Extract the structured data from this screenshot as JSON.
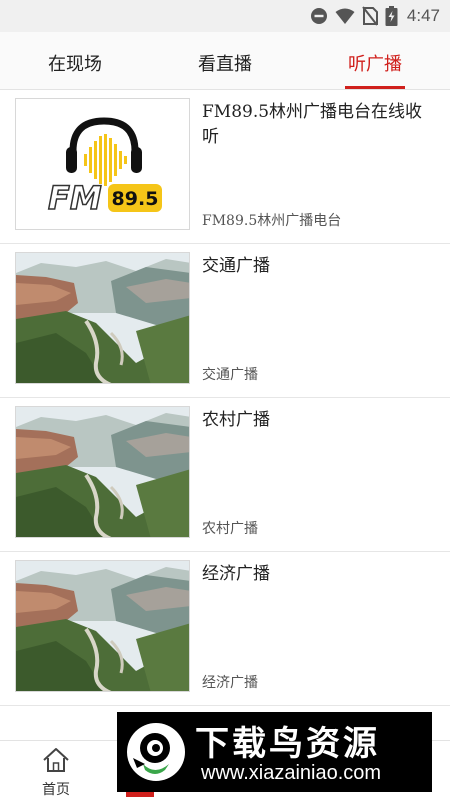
{
  "status_bar": {
    "time": "4:47",
    "icons": [
      "dnd-icon",
      "wifi-icon",
      "no-sim-icon",
      "battery-charging-icon"
    ]
  },
  "tabs": [
    {
      "label": "在现场",
      "active": false
    },
    {
      "label": "看直播",
      "active": false
    },
    {
      "label": "听广播",
      "active": true
    }
  ],
  "list": [
    {
      "title": "FM89.5林州广播电台在线收听",
      "subtitle": "FM89.5林州广播电台",
      "thumb": "fm-logo",
      "logo_text": "FM",
      "logo_freq": "89.5"
    },
    {
      "title": "交通广播",
      "subtitle": "交通广播",
      "thumb": "mountain-photo"
    },
    {
      "title": "农村广播",
      "subtitle": "农村广播",
      "thumb": "mountain-photo"
    },
    {
      "title": "经济广播",
      "subtitle": "经济广播",
      "thumb": "mountain-photo"
    }
  ],
  "bottom_nav": {
    "home_label": "首页"
  },
  "watermark": {
    "name": "下载鸟资源",
    "url": "www.xiazainiao.com"
  },
  "colors": {
    "accent": "#d0201c",
    "logo_yellow": "#f5c518"
  }
}
